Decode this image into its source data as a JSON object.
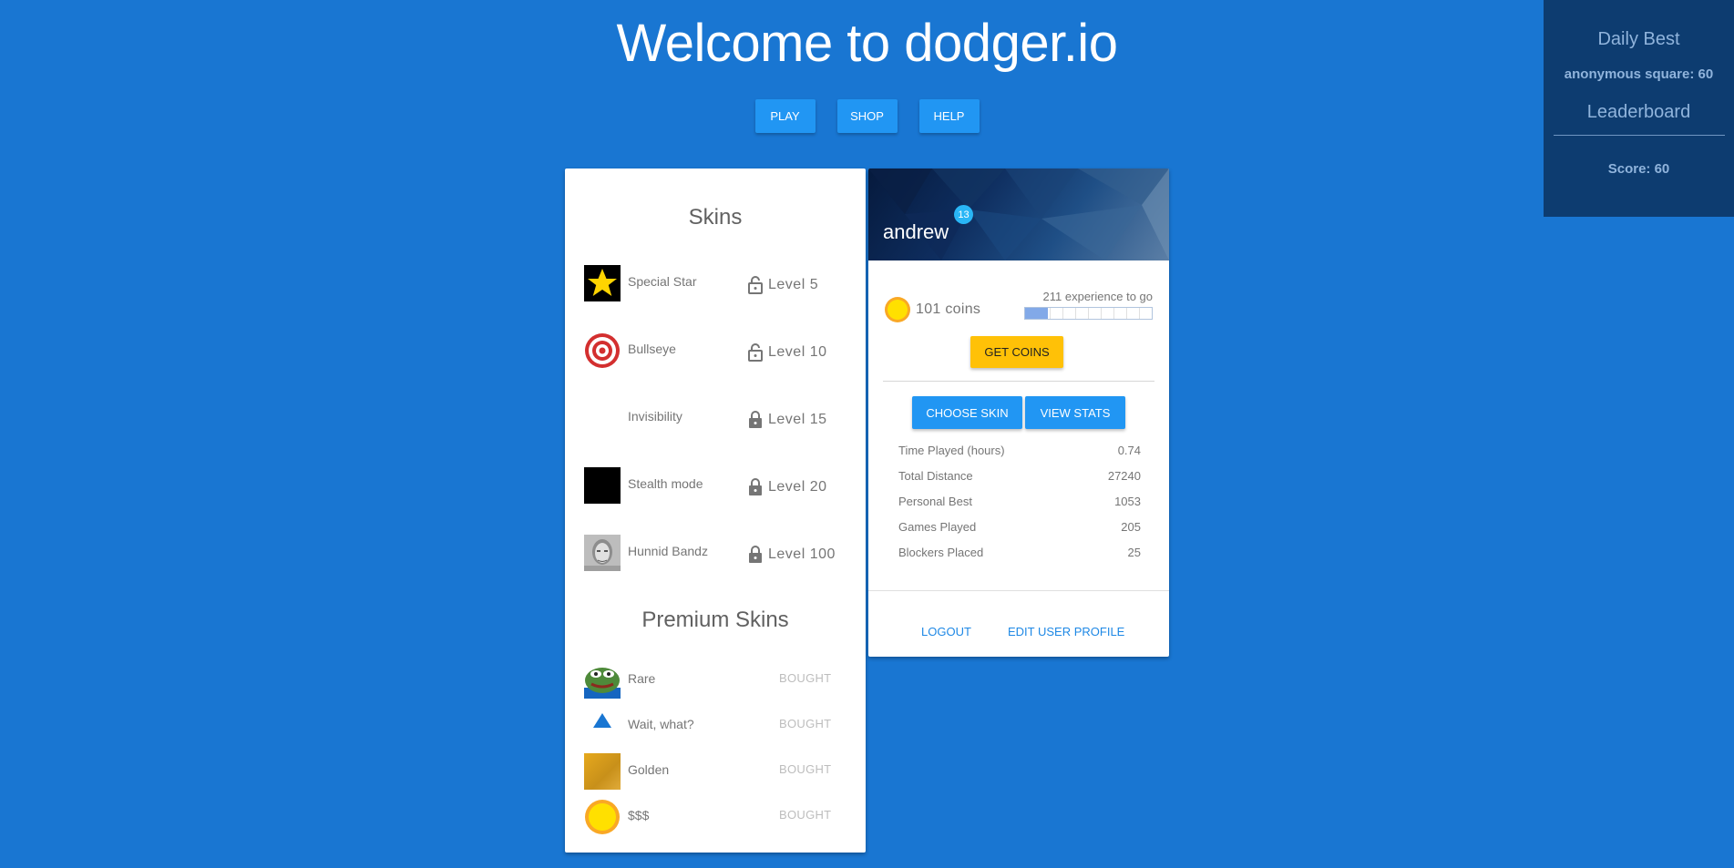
{
  "header": {
    "title": "Welcome to dodger.io"
  },
  "nav": {
    "play": "PLAY",
    "shop": "SHOP",
    "help": "HELP"
  },
  "leaderboard_panel": {
    "daily_best_title": "Daily Best",
    "daily_best_entry": "anonymous square: 60",
    "leaderboard_title": "Leaderboard",
    "score": "Score: 60"
  },
  "skins": {
    "title": "Skins",
    "items": [
      {
        "name": "Special Star",
        "level": "Level 5",
        "lock": "unlocked-lock-icon"
      },
      {
        "name": "Bullseye",
        "level": "Level 10",
        "lock": "unlocked-lock-icon"
      },
      {
        "name": "Invisibility",
        "level": "Level 15",
        "lock": "lock-icon"
      },
      {
        "name": "Stealth mode",
        "level": "Level 20",
        "lock": "lock-icon"
      },
      {
        "name": "Hunnid Bandz",
        "level": "Level 100",
        "lock": "lock-icon"
      }
    ],
    "premium_title": "Premium Skins",
    "premium_items": [
      {
        "name": "Rare",
        "status": "BOUGHT"
      },
      {
        "name": "Wait, what?",
        "status": "BOUGHT"
      },
      {
        "name": "Golden",
        "status": "BOUGHT"
      },
      {
        "name": "$$$",
        "status": "BOUGHT"
      }
    ]
  },
  "profile": {
    "username": "andrew",
    "level": "13",
    "coins": "101 coins",
    "experience_label": "211 experience to go",
    "experience_progress": 0.18,
    "get_coins": "GET COINS",
    "choose_skin": "CHOOSE SKIN",
    "view_stats": "VIEW STATS",
    "stats": [
      {
        "label": "Time Played (hours)",
        "value": "0.74"
      },
      {
        "label": "Total Distance",
        "value": "27240"
      },
      {
        "label": "Personal Best",
        "value": "1053"
      },
      {
        "label": "Games Played",
        "value": "205"
      },
      {
        "label": "Blockers Placed",
        "value": "25"
      }
    ],
    "logout": "LOGOUT",
    "edit_profile": "EDIT USER PROFILE"
  },
  "colors": {
    "background": "#1976d2",
    "button": "#2196f3",
    "accent": "#ffc107",
    "panel": "#0d3c70"
  }
}
